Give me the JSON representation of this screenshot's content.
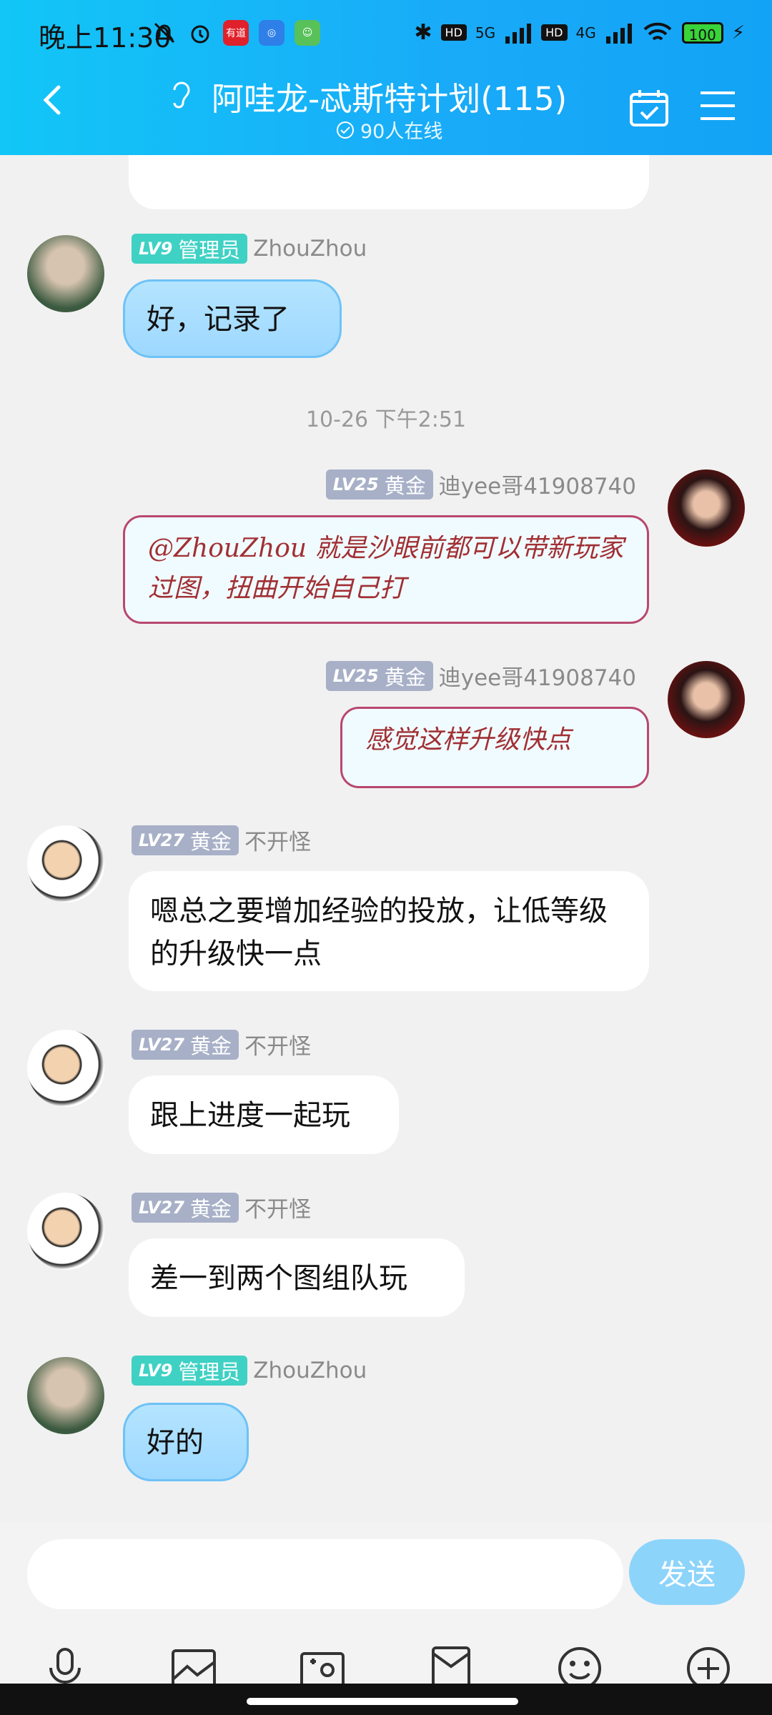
{
  "status_bar": {
    "time": "晚上11:30",
    "battery": "100",
    "network": [
      "5G",
      "4G"
    ]
  },
  "header": {
    "title": "阿哇龙-忒斯特计划(115)",
    "online": "90人在线"
  },
  "messages": [
    {
      "badge_level": "LV9",
      "badge_role": "管理员",
      "name": "ZhouZhou",
      "text": "好，记录了"
    },
    {
      "timestamp": "10-26 下午2:51"
    },
    {
      "badge_level": "LV25",
      "badge_role": "黄金",
      "name": "迪yee哥41908740",
      "text": "@ZhouZhou 就是沙眼前都可以带新玩家过图，扭曲开始自己打"
    },
    {
      "badge_level": "LV25",
      "badge_role": "黄金",
      "name": "迪yee哥41908740",
      "text": "感觉这样升级快点"
    },
    {
      "badge_level": "LV27",
      "badge_role": "黄金",
      "name": "不开怪",
      "text": "嗯总之要增加经验的投放，让低等级的升级快一点"
    },
    {
      "badge_level": "LV27",
      "badge_role": "黄金",
      "name": "不开怪",
      "text": "跟上进度一起玩"
    },
    {
      "badge_level": "LV27",
      "badge_role": "黄金",
      "name": "不开怪",
      "text": "差一到两个图组队玩"
    },
    {
      "badge_level": "LV9",
      "badge_role": "管理员",
      "name": "ZhouZhou",
      "text": "好的"
    }
  ],
  "composer": {
    "send_label": "发送",
    "placeholder": ""
  },
  "colors": {
    "header": "#19aaf8",
    "admin_badge": "#3fd1c4",
    "gold_badge": "#a7b0c7",
    "send_button": "#8dd4fb"
  }
}
